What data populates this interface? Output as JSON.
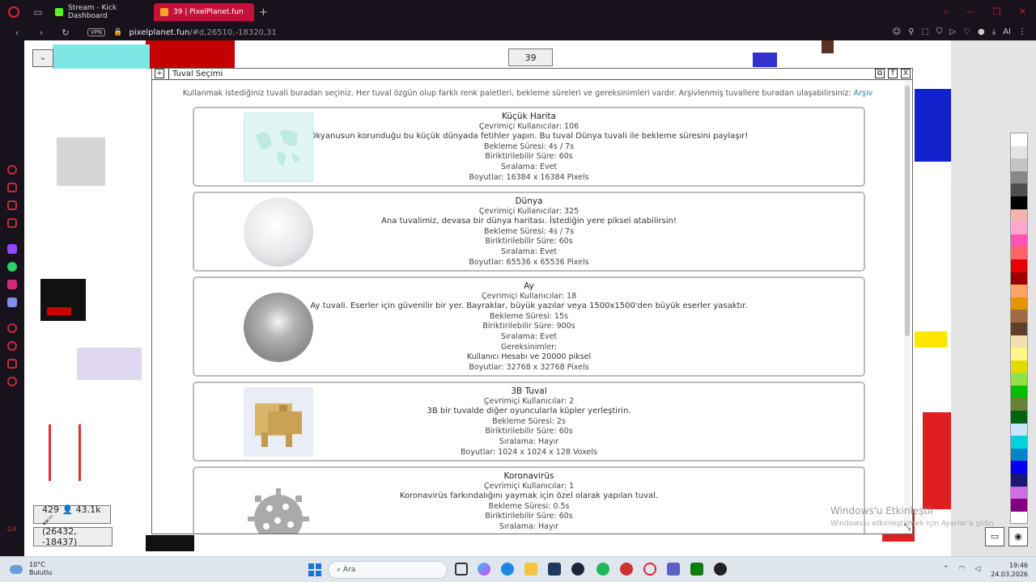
{
  "browser": {
    "tabs": [
      {
        "label": "Stream - Kick Dashboard",
        "favicon_color": "#53fc18"
      },
      {
        "label": "39 | PixelPlanet.fun",
        "favicon_color": "#f5a623"
      }
    ],
    "url_host": "pixelplanet.fun",
    "url_path": "/#d,26510,-18320,31",
    "vpn_label": "VPN",
    "ai_label": "AI"
  },
  "canvas": {
    "online_count": "39",
    "menu_glyph": "⌄",
    "user_stats": "429 👤 43.1k 🖌",
    "coordinates": "(26432, -18437)"
  },
  "palette": {
    "colors": [
      "#ffffff",
      "#e4e4e4",
      "#c4c4c4",
      "#888888",
      "#4e4e4e",
      "#000000",
      "#f4b3ae",
      "#ffa7d1",
      "#ff54b2",
      "#ff6565",
      "#e50000",
      "#9a0000",
      "#fea460",
      "#e59500",
      "#a06a42",
      "#604028",
      "#f5dfb0",
      "#fff889",
      "#e5d900",
      "#94e044",
      "#02be01",
      "#688338",
      "#006513",
      "#cae3ff",
      "#00d3dd",
      "#0083c7",
      "#0000ea",
      "#191973",
      "#cf6ee4",
      "#820080"
    ]
  },
  "modal": {
    "title": "Tuval Seçimi",
    "intro": "Kullanmak istediğiniz tuvali buradan seçiniz. Her tuval özgün olup farklı renk paletleri, bekleme süreleri ve gereksinimleri vardır. Arşivlenmiş tuvallere buradan ulaşabilirsiniz:",
    "archive_link": "Arşiv",
    "canvases": [
      {
        "name": "Küçük Harita",
        "online": "Çevrimiçi Kullanıcılar: 106",
        "description": "Okyanusun korunduğu bu küçük dünyada fetihler yapın. Bu tuval Dünya tuvali ile bekleme süresini paylaşır!",
        "cooldown": "Bekleme Süresi:  4s / 7s",
        "stackable": "Biriktirilebilir Süre:  60s",
        "ranked": "Sıralama: Evet",
        "requirements_title": "",
        "requirements": "",
        "size": "Boyutlar:  16384 x 16384 Pixels"
      },
      {
        "name": "Dünya",
        "online": "Çevrimiçi Kullanıcılar: 325",
        "description": "Ana tuvalimiz, devasa bir dünya haritası. İstediğin yere piksel atabilirsin!",
        "cooldown": "Bekleme Süresi:  4s / 7s",
        "stackable": "Biriktirilebilir Süre:  60s",
        "ranked": "Sıralama: Evet",
        "requirements_title": "",
        "requirements": "",
        "size": "Boyutlar:  65536 x 65536 Pixels"
      },
      {
        "name": "Ay",
        "online": "Çevrimiçi Kullanıcılar: 18",
        "description": "Ay tuvali. Eserler için güvenilir bir yer. Bayraklar, büyük yazılar veya 1500x1500'den büyük eserler yasaktır.",
        "cooldown": "Bekleme Süresi:  15s",
        "stackable": "Biriktirilebilir Süre:  900s",
        "ranked": "Sıralama: Evet",
        "requirements_title": "Gereksinimler:",
        "requirements": "Kullanıcı Hesabı ve 20000 piksel",
        "size": "Boyutlar:  32768 x 32768 Pixels"
      },
      {
        "name": "3B Tuval",
        "online": "Çevrimiçi Kullanıcılar: 2",
        "description": "3B bir tuvalde diğer oyuncularla küpler yerleştirin.",
        "cooldown": "Bekleme Süresi:  2s",
        "stackable": "Biriktirilebilir Süre:  60s",
        "ranked": "Sıralama: Hayır",
        "requirements_title": "",
        "requirements": "",
        "size": "Boyutlar:  1024 x 1024 x 128 Voxels"
      },
      {
        "name": "Koronavirüs",
        "online": "Çevrimiçi Kullanıcılar: 1",
        "description": "Koronavirüs farkındalığını yaymak için özel olarak yapılan tuval.",
        "cooldown": "Bekleme Süresi:  0.5s",
        "stackable": "Biriktirilebilir Süre:  60s",
        "ranked": "Sıralama: Hayır",
        "requirements_title": "",
        "requirements": "",
        "size": ""
      }
    ]
  },
  "watermark": {
    "line1": "Windows'u Etkinleştir",
    "line2": "Windows'u etkinleştirmek için Ayarlar'a gidin."
  },
  "taskbar": {
    "temperature": "10°C",
    "weather": "Bulutlu",
    "search_placeholder": "Ara",
    "time": "19:46",
    "date": "24.03.2026"
  }
}
